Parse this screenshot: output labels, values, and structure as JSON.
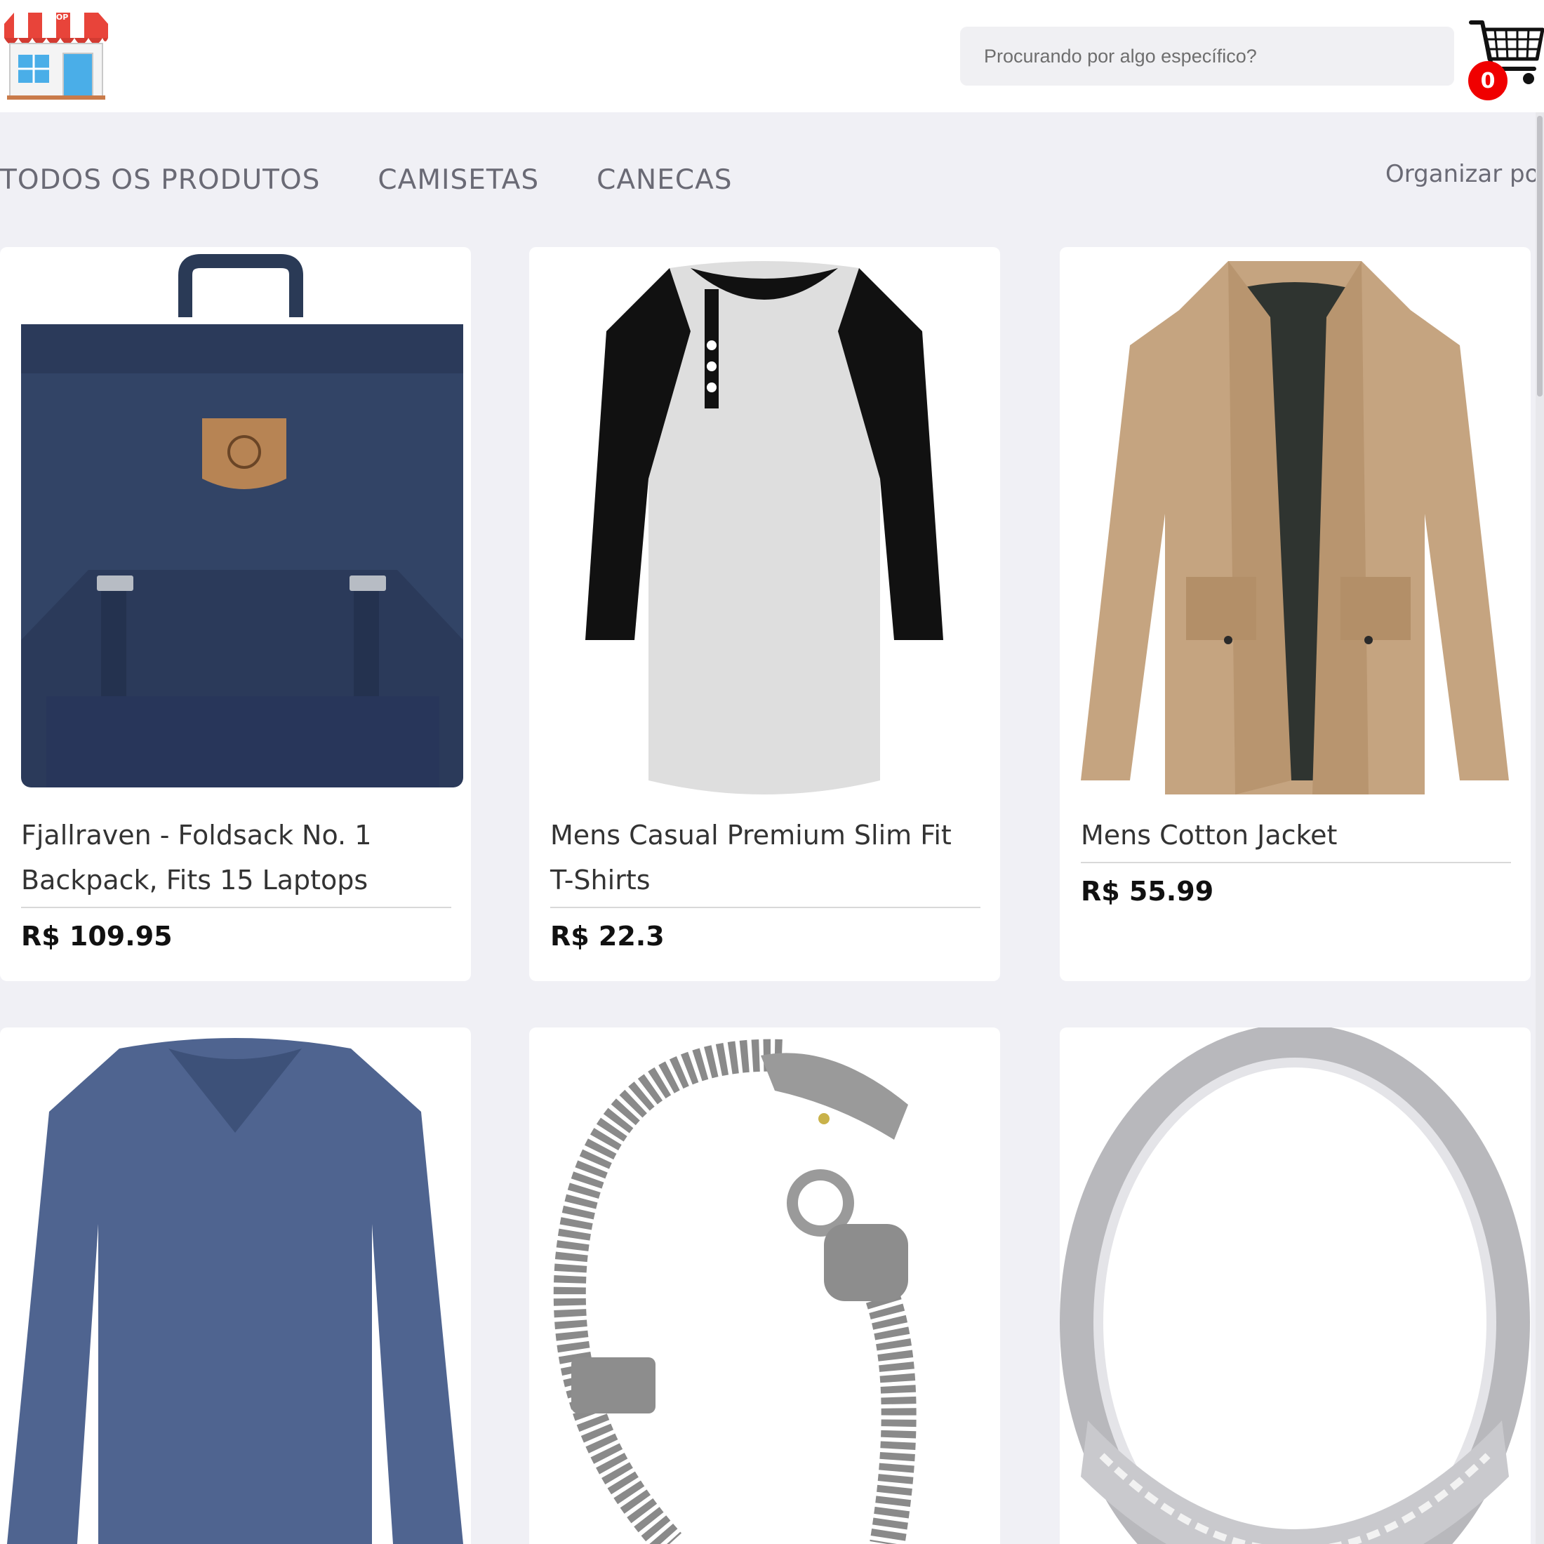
{
  "header": {
    "logo_text": "SHOP",
    "search_placeholder": "Procurando por algo específico?",
    "cart_count": "0"
  },
  "nav": {
    "tabs": [
      {
        "label": "TODOS OS PRODUTOS"
      },
      {
        "label": "CAMISETAS"
      },
      {
        "label": "CANECAS"
      }
    ],
    "sort_label": "Organizar por"
  },
  "products": [
    {
      "title": "Fjallraven - Foldsack No. 1 Backpack, Fits 15 Laptops",
      "price": "R$ 109.95",
      "icon": "backpack-icon"
    },
    {
      "title": "Mens Casual Premium Slim Fit T-Shirts",
      "price": "R$ 22.3",
      "icon": "raglan-tshirt-icon"
    },
    {
      "title": "Mens Cotton Jacket",
      "price": "R$ 55.99",
      "icon": "jacket-icon"
    },
    {
      "icon": "long-sleeve-shirt-icon"
    },
    {
      "icon": "dragon-bracelet-icon"
    },
    {
      "icon": "silver-ring-icon"
    }
  ],
  "colors": {
    "background": "#f0f0f5",
    "card": "#ffffff",
    "badge": "#f00000",
    "tab_text": "#6a6a75"
  }
}
